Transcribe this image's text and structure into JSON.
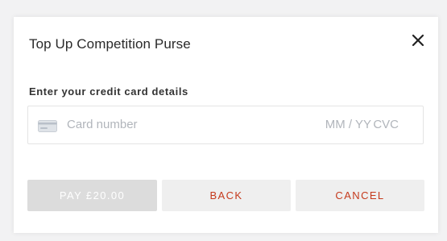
{
  "dialog": {
    "title": "Top Up Competition Purse",
    "close_icon": "close-icon"
  },
  "card_form": {
    "label": "Enter your credit card details",
    "card_icon": "credit-card-icon",
    "number_placeholder": "Card number",
    "expiry_placeholder": "MM / YY",
    "cvc_placeholder": "CVC"
  },
  "buttons": {
    "pay_label": "PAY £20.00",
    "back_label": "BACK",
    "cancel_label": "CANCEL"
  },
  "colors": {
    "accent": "#c53a1d",
    "disabled_button": "#dcdcdc",
    "placeholder_text": "#b1b5bb"
  }
}
